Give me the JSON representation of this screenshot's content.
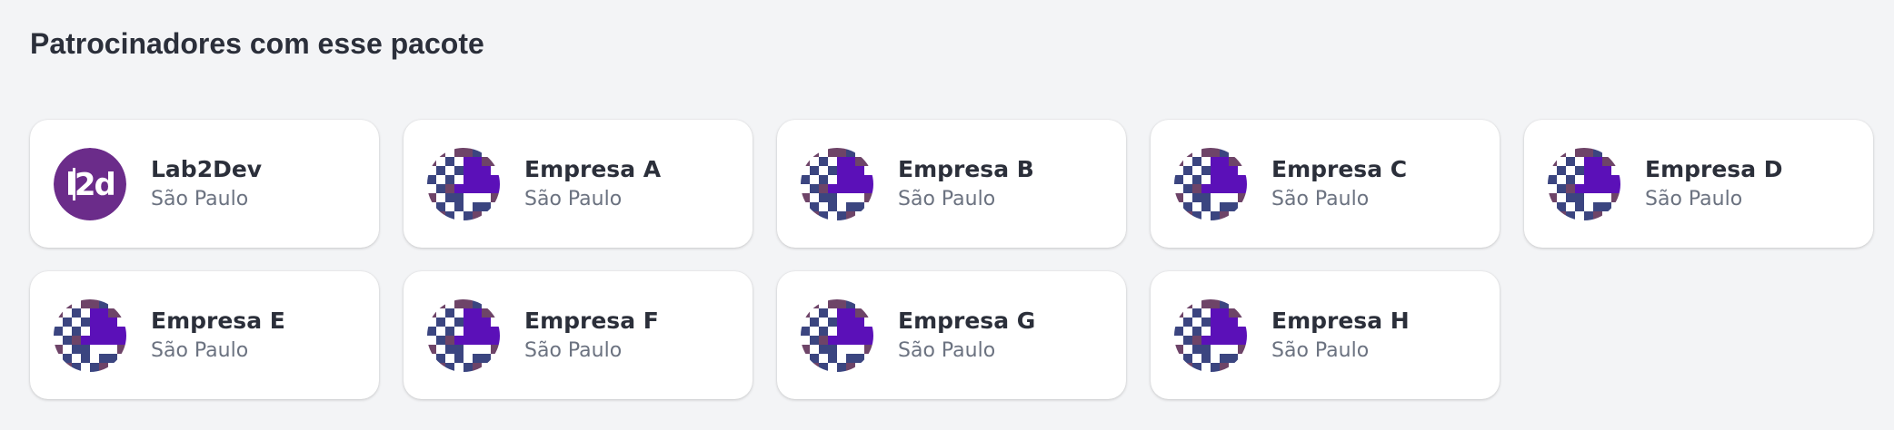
{
  "section": {
    "title": "Patrocinadores com esse pacote"
  },
  "sponsors": [
    {
      "name": "Lab2Dev",
      "location": "São Paulo",
      "logo": "lab2dev-logo"
    },
    {
      "name": "Empresa A",
      "location": "São Paulo",
      "logo": "pixel-avatar"
    },
    {
      "name": "Empresa B",
      "location": "São Paulo",
      "logo": "pixel-avatar"
    },
    {
      "name": "Empresa C",
      "location": "São Paulo",
      "logo": "pixel-avatar"
    },
    {
      "name": "Empresa D",
      "location": "São Paulo",
      "logo": "pixel-avatar"
    },
    {
      "name": "Empresa E",
      "location": "São Paulo",
      "logo": "pixel-avatar"
    },
    {
      "name": "Empresa F",
      "location": "São Paulo",
      "logo": "pixel-avatar"
    },
    {
      "name": "Empresa G",
      "location": "São Paulo",
      "logo": "pixel-avatar"
    },
    {
      "name": "Empresa H",
      "location": "São Paulo",
      "logo": "pixel-avatar"
    }
  ],
  "colors": {
    "background": "#f3f4f6",
    "card": "#ffffff",
    "text_primary": "#2b2f3a",
    "text_secondary": "#6b7280",
    "lab2dev_purple": "#6b2c8a",
    "pixel_violet": "#5b10b8",
    "pixel_navy": "#3b4580",
    "pixel_plum": "#6e4468"
  }
}
